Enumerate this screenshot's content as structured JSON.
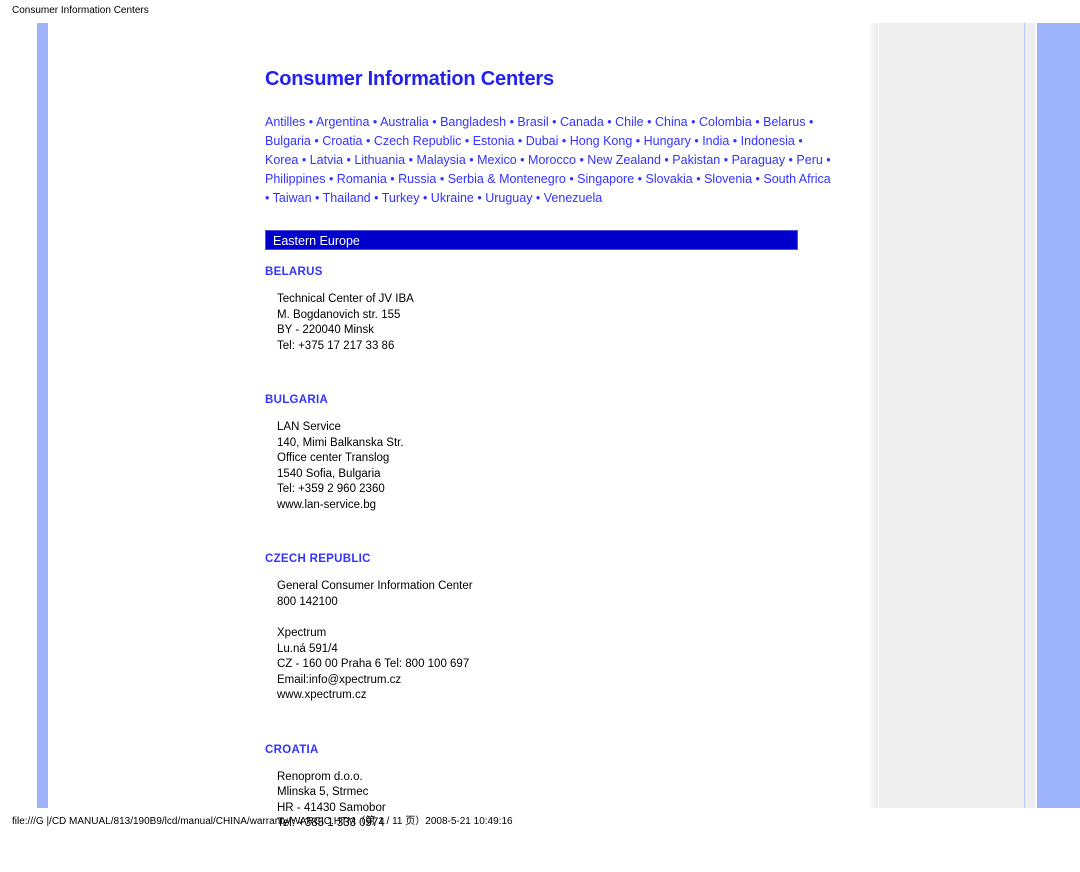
{
  "print_header": "Consumer Information Centers",
  "print_footer": "file:///G |/CD MANUAL/813/190B9/lcd/manual/CHINA/warranty/WARCIC.HTM（第 1 / 11 页）2008-5-21 10:49:16",
  "colors": {
    "title_blue": "#2222ee",
    "link_blue": "#3333ff",
    "banner_blue": "#0000cc",
    "accent_bar_blue": "#9db4fb",
    "page_backdrop_gray": "#efefef"
  },
  "document": {
    "title": "Consumer Information Centers",
    "separator": "•",
    "country_links": [
      "Antilles",
      "Argentina",
      "Australia",
      "Bangladesh",
      "Brasil",
      "Canada",
      "Chile",
      "China",
      "Colombia",
      "Belarus",
      "Bulgaria",
      "Croatia",
      "Czech Republic",
      "Estonia",
      "Dubai",
      "Hong Kong",
      "Hungary",
      "India",
      "Indonesia",
      "Korea",
      "Latvia",
      "Lithuania",
      "Malaysia",
      "Mexico",
      "Morocco",
      "New Zealand",
      "Pakistan",
      "Paraguay",
      "Peru",
      "Philippines",
      "Romania",
      "Russia",
      "Serbia & Montenegro",
      "Singapore",
      "Slovakia",
      "Slovenia",
      "South Africa",
      "Taiwan",
      "Thailand",
      "Turkey",
      "Ukraine",
      "Uruguay",
      "Venezuela"
    ],
    "region_banner": "Eastern Europe",
    "sections": [
      {
        "heading": "BELARUS",
        "blocks": [
          {
            "lines": [
              "Technical Center of JV IBA",
              "M. Bogdanovich str. 155",
              "BY - 220040 Minsk",
              "Tel: +375 17 217 33 86"
            ]
          }
        ]
      },
      {
        "heading": "BULGARIA",
        "blocks": [
          {
            "lines": [
              "LAN Service",
              "140, Mimi Balkanska Str.",
              "Office center Translog",
              "1540 Sofia, Bulgaria",
              "Tel: +359 2 960 2360",
              "www.lan-service.bg"
            ]
          }
        ]
      },
      {
        "heading": "CZECH REPUBLIC",
        "blocks": [
          {
            "lines": [
              "General Consumer Information Center",
              "800 142100"
            ]
          },
          {
            "lines": [
              "Xpectrum",
              "Lu.ná 591/4",
              "CZ - 160 00 Praha 6 Tel: 800 100 697",
              "Email:info@xpectrum.cz",
              "www.xpectrum.cz"
            ]
          }
        ]
      },
      {
        "heading": "CROATIA",
        "blocks": [
          {
            "lines": [
              "Renoprom d.o.o.",
              "Mlinska 5, Strmec",
              "HR - 41430 Samobor",
              "Tel: +385 1 333 0974"
            ]
          }
        ]
      }
    ]
  }
}
